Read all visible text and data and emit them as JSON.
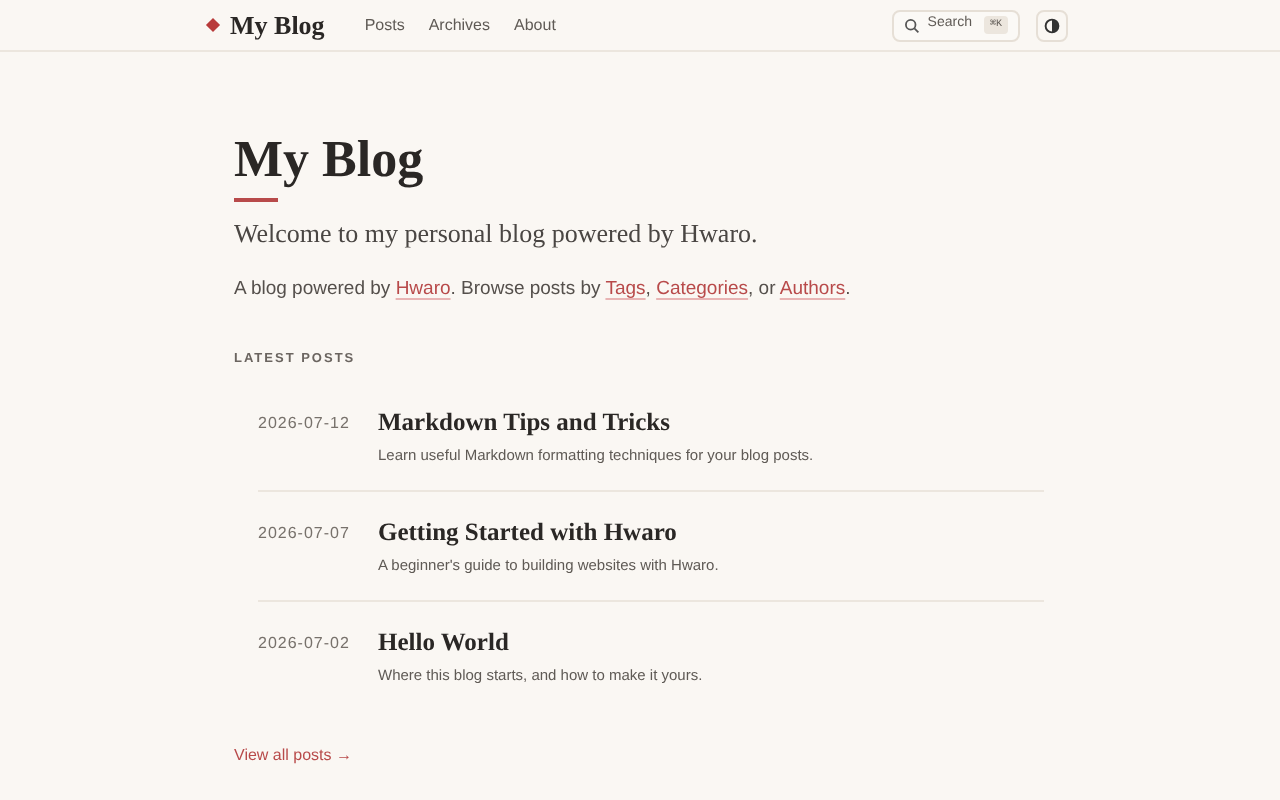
{
  "header": {
    "brand": "My Blog",
    "nav": [
      {
        "label": "Posts"
      },
      {
        "label": "Archives"
      },
      {
        "label": "About"
      }
    ],
    "search": {
      "label": "Search",
      "shortcut": "⌘K"
    }
  },
  "hero": {
    "title": "My Blog",
    "subtitle": "Welcome to my personal blog powered by Hwaro.",
    "intro": [
      {
        "kind": "text",
        "text": "A blog powered by "
      },
      {
        "kind": "link",
        "text": "Hwaro"
      },
      {
        "kind": "text",
        "text": ". Browse posts by "
      },
      {
        "kind": "link",
        "text": "Tags"
      },
      {
        "kind": "text",
        "text": ", "
      },
      {
        "kind": "link",
        "text": "Categories"
      },
      {
        "kind": "text",
        "text": ", or "
      },
      {
        "kind": "link",
        "text": "Authors"
      },
      {
        "kind": "text",
        "text": "."
      }
    ]
  },
  "latest": {
    "heading": "LATEST POSTS",
    "posts": [
      {
        "date": "2026-07-12",
        "title": "Markdown Tips and Tricks",
        "summary": "Learn useful Markdown formatting techniques for your blog posts."
      },
      {
        "date": "2026-07-07",
        "title": "Getting Started with Hwaro",
        "summary": "A beginner's guide to building websites with Hwaro."
      },
      {
        "date": "2026-07-02",
        "title": "Hello World",
        "summary": "Where this blog starts, and how to make it yours."
      }
    ],
    "view_all": "View all posts →"
  }
}
